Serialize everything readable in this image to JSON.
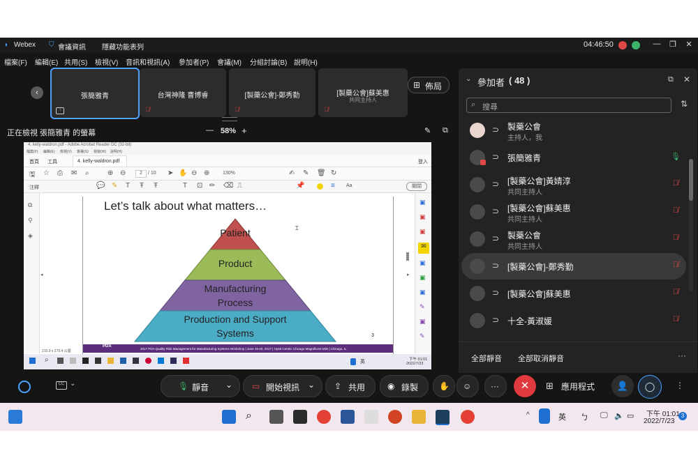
{
  "window": {
    "app_name": "Webex",
    "meeting_info": "會議資訊",
    "hide_features": "隱藏功能表列",
    "clock": "04:46:50",
    "controls": {
      "minimize": "—",
      "restore": "❐",
      "close": "✕"
    }
  },
  "menu": [
    "檔案(F)",
    "編輯(E)",
    "共用(S)",
    "檢視(V)",
    "音訊和視訊(A)",
    "參加者(P)",
    "會議(M)",
    "分組討論(B)",
    "說明(H)"
  ],
  "tiles": [
    {
      "name": "張簡雅青",
      "sub": ""
    },
    {
      "name": "台灣神隆 曹博睿",
      "sub": ""
    },
    {
      "name": "[製藥公會]-鄭秀勤",
      "sub": ""
    },
    {
      "name": "[製藥公會]蘇美惠",
      "sub": "共同主持人"
    }
  ],
  "layout_button": "佈局",
  "viewer": {
    "label": "正在檢視 張簡雅青 的螢幕",
    "zoom": "58%",
    "minus": "—",
    "plus": "+"
  },
  "shared_screen": {
    "window_title": "4. kelly-waldron.pdf - Adobe Acrobat Reader DC (32-bit)",
    "menu": [
      "檔案(F)",
      "編輯(E)",
      "檢視(V)",
      "簽署(S)",
      "視窗(W)",
      "說明(H)"
    ],
    "tabs": [
      "首頁",
      "工具",
      "4. kelly-waldron.pdf"
    ],
    "signin": "登入",
    "page": "2",
    "pages": "/ 10",
    "zoom": "130%",
    "comment_label": "注釋",
    "close_label": "關閉",
    "slide_title": "Let’s talk about what matters…",
    "pyramid": [
      "Patient",
      "Product",
      "Manufacturing Process",
      "Production and Support Systems"
    ],
    "footer_logo": "PDA",
    "footer_text": "2017 PDA Quality Risk Management for Manufacturing Systems Workshop | June 19-20, 2017 | Hyatt Centric Chicago Magnificent Mile | Chicago, IL",
    "slide_number": "3",
    "page_size": "215.9 x 279.4 公厘",
    "taskbar_ime": "英",
    "taskbar_time": "下午 01:01",
    "taskbar_date": "2022/7/23"
  },
  "participants": {
    "title": "參加者",
    "count": "( 48 )",
    "search_placeholder": "搜尋",
    "list": [
      {
        "name": "製藥公會",
        "role": "主持人，我",
        "mic": "none"
      },
      {
        "name": "張簡雅青",
        "role": "",
        "mic": "on"
      },
      {
        "name": "[製藥公會]黃婧淳",
        "role": "共同主持人",
        "mic": "muted"
      },
      {
        "name": "[製藥公會]蘇美惠",
        "role": "共同主持人",
        "mic": "muted"
      },
      {
        "name": "製藥公會",
        "role": "共同主持人",
        "mic": "muted"
      },
      {
        "name": "[製藥公會]-鄭秀勤",
        "role": "",
        "mic": "muted"
      },
      {
        "name": "[製藥公會]蘇美惠",
        "role": "",
        "mic": "muted"
      },
      {
        "name": "十全-黃淑媛",
        "role": "",
        "mic": "muted"
      }
    ],
    "mute_all": "全部靜音",
    "unmute_all": "全部取消靜音"
  },
  "controls": {
    "mute": "靜音",
    "start_video": "開始視訊",
    "share": "共用",
    "record": "錄製",
    "apps": "應用程式"
  },
  "taskbar": {
    "ime": "英",
    "time": "下午 01:01",
    "date": "2022/7/23",
    "badge": "3"
  },
  "colors": {
    "app_bg": "#151515",
    "panel_bg": "#232323",
    "accent": "#4da3ff",
    "end_call": "#e0393e",
    "muted": "#e04848",
    "pyramid": [
      "#c0504d",
      "#9bbb59",
      "#8064a2",
      "#4bacc6"
    ]
  }
}
